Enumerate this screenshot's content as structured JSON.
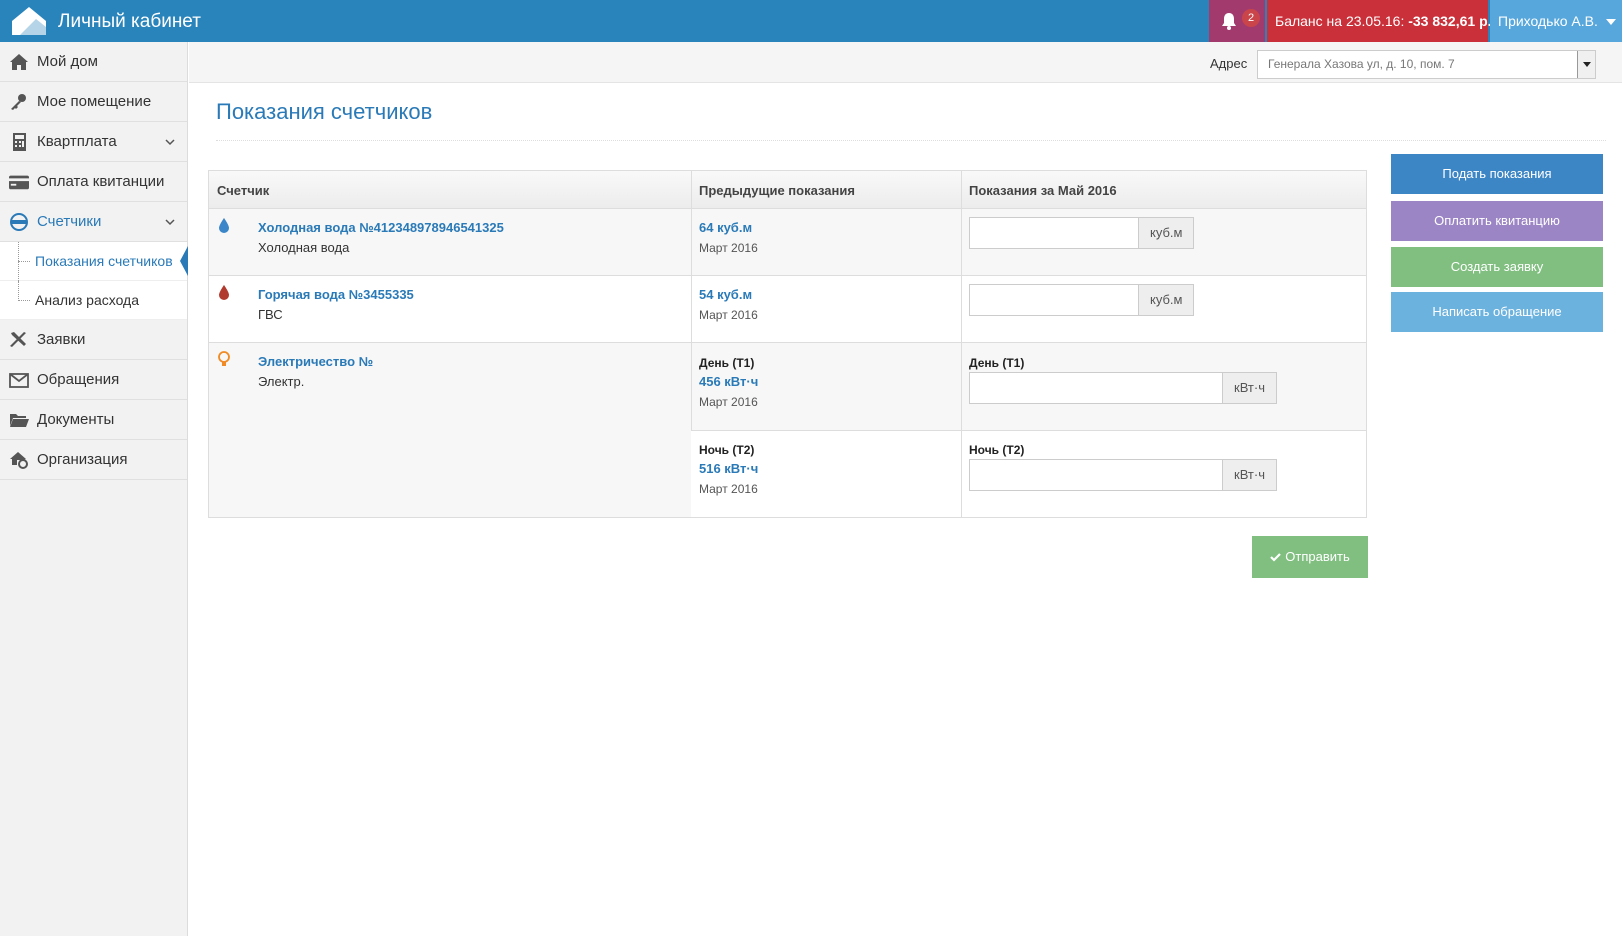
{
  "header": {
    "app_title": "Личный кабинет",
    "notification_count": "2",
    "balance_label": "Баланс на 23.05.16:",
    "balance_amount": "-33 832,61 р.",
    "user_name": "Приходько А.В.",
    "colors": {
      "bar": "#2a84bc",
      "notifications": "#a23a6e",
      "balance": "#c9303a",
      "user": "#57a7dc"
    }
  },
  "sidebar": {
    "items": [
      {
        "label": "Мой дом",
        "icon": "home-icon"
      },
      {
        "label": "Мое помещение",
        "icon": "key-icon"
      },
      {
        "label": "Квартплата",
        "icon": "calculator-icon"
      },
      {
        "label": "Оплата квитанции",
        "icon": "credit-card-icon"
      },
      {
        "label": "Счетчики",
        "icon": "meter-icon"
      },
      {
        "label": "Заявки",
        "icon": "tools-icon"
      },
      {
        "label": "Обращения",
        "icon": "envelope-icon"
      },
      {
        "label": "Документы",
        "icon": "folder-icon"
      },
      {
        "label": "Организация",
        "icon": "organization-icon"
      }
    ],
    "submenu": [
      {
        "label": "Показания счетчиков",
        "active": true
      },
      {
        "label": "Анализ расхода",
        "active": false
      }
    ]
  },
  "address": {
    "label": "Адрес",
    "selected": "Генерала Хазова ул, д. 10, пом. 7"
  },
  "page": {
    "title": "Показания счетчиков"
  },
  "table": {
    "headers": [
      "Счетчик",
      "Предыдущие показания",
      "Показания за Май 2016"
    ],
    "rows": [
      {
        "name": "Холодная вода №412348978946541325",
        "type": "Холодная вода",
        "icon": "water-drop-icon",
        "prev_value": "64 куб.м",
        "prev_date": "Март 2016",
        "unit": "куб.м"
      },
      {
        "name": "Горячая вода №3455335",
        "type": "ГВС",
        "icon": "hot-water-drop-icon",
        "prev_value": "54 куб.м",
        "prev_date": "Март 2016",
        "unit": "куб.м"
      },
      {
        "name": "Электричество №",
        "type": "Электр.",
        "icon": "lightbulb-icon",
        "tariffs": [
          {
            "label": "День (Т1)",
            "prev_value": "456 кВт·ч",
            "prev_date": "Март 2016",
            "unit": "кВт·ч"
          },
          {
            "label": "Ночь (Т2)",
            "prev_value": "516 кВт·ч",
            "prev_date": "Март 2016",
            "unit": "кВт·ч"
          }
        ]
      }
    ]
  },
  "submit_label": "Отправить",
  "actions": [
    {
      "label": "Подать показания",
      "color": "#3d86c6"
    },
    {
      "label": "Оплатить квитанцию",
      "color": "#9b85c4"
    },
    {
      "label": "Создать заявку",
      "color": "#80bf80"
    },
    {
      "label": "Написать обращение",
      "color": "#6cb2de"
    }
  ]
}
